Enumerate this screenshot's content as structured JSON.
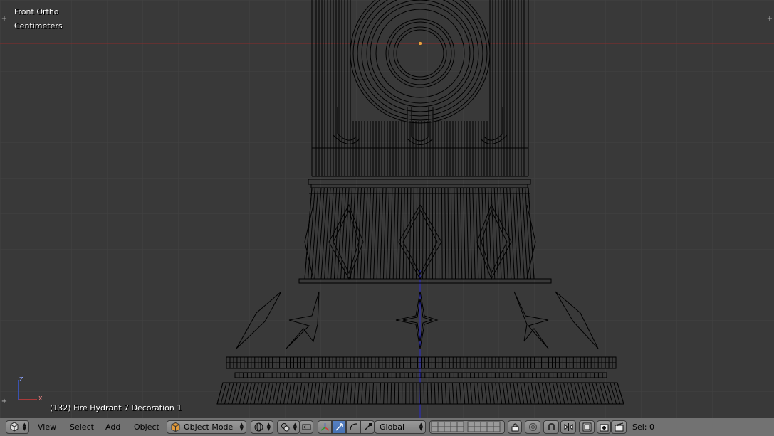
{
  "viewport": {
    "view_name": "Front Ortho",
    "units": "Centimeters",
    "object_info": "(132) Fire Hydrant 7 Decoration 1",
    "axis_labels": {
      "z": "Z",
      "x": "X"
    }
  },
  "header": {
    "menus": [
      "View",
      "Select",
      "Add",
      "Object"
    ],
    "mode": "Object Mode",
    "orientation": "Global",
    "selection": "Sel: 0"
  },
  "colors": {
    "grid_bg": "#393939",
    "grid_line": "#424242",
    "wire": "#000000",
    "x_axis": "#8c2a2a",
    "z_axis": "#2a2ad0",
    "header_bg": "#727272",
    "active_button": "#5680c2"
  },
  "icons": [
    "editor-type-icon",
    "mode-cube-icon",
    "viewport-shading-icon",
    "pivot-icon",
    "manipulator-icon",
    "translate-icon",
    "rotate-icon",
    "scale-icon",
    "layers-grid-icon",
    "lock-icon",
    "proportional-icon",
    "snap-icon",
    "mirror-icon",
    "render-icon",
    "clapper-icon"
  ]
}
